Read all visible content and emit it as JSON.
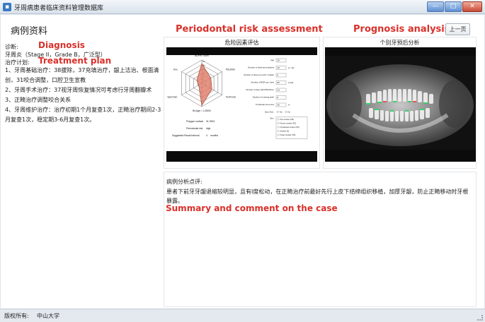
{
  "window": {
    "title": "牙周病患者临床资料管理数据库",
    "buttons": {
      "minimize": "—",
      "maximize": "□",
      "close": "✕"
    }
  },
  "header": {
    "page_title": "病例资料",
    "annotations": {
      "risk": "Periodontal risk assessment",
      "prognosis": "Prognosis analysis"
    },
    "prev_button": "上一页"
  },
  "case": {
    "diagnosis_label": "诊断:",
    "diagnosis_annotation": "Diagnosis",
    "diagnosis_text": "牙周炎（Stage II，Grade B，广泛型）",
    "plan_label": "治疗计划:",
    "plan_annotation": "Treatment plan",
    "steps": [
      "1、牙周基础治疗：38拔除，37充填治疗，龈上洁治、根面清创，31咬合调整，口腔卫生宣教",
      "2、牙周手术治疗：37视牙周恢复情况可考虑行牙周翻瓣术",
      "3、正畸治疗调整咬合关系",
      "4、牙周维护治疗：治疗初期1个月复查1次，正畸治疗期间2-3月复查1次，稳定期3-6月复查1次。"
    ]
  },
  "risk_panel": {
    "caption": "危险因素评估",
    "radar": {
      "axes": [
        "BOP% = 64%",
        "PD≥5mm",
        "Tooth loss",
        "BL/Age = 1.00000",
        "Syst./Gen.",
        "Env."
      ],
      "ring_labels": [
        "4",
        "8",
        "10",
        "15",
        "20",
        "25"
      ],
      "values": [
        0.85,
        0.45,
        0.5,
        0.95,
        0.15,
        0.25
      ],
      "fill_color": "#e07a66"
    },
    "summary": {
      "polygon_surface_label": "Polygon surface",
      "polygon_surface_value": "31.0924",
      "risk_label": "Periodontal risk",
      "risk_value": "high",
      "recall_label": "Suggested Recall interval",
      "recall_value": "4",
      "recall_unit": "months"
    },
    "form": {
      "rows": [
        {
          "label": "age",
          "value": "30",
          "unit": ""
        },
        {
          "label": "Number of teeth and implants",
          "value": "20",
          "unit": "(1 - 32)"
        },
        {
          "label": "Number of sites per tooth / implant",
          "value": "6",
          "unit": ""
        },
        {
          "label": "Number of BOP-pos. sites",
          "value": "80",
          "unit": "of  120"
        },
        {
          "label": "Number of sites with PPD≥5mm",
          "value": "24",
          "unit": ""
        },
        {
          "label": "Number of missing teeth",
          "value": "8",
          "unit": ""
        },
        {
          "label": "% Alveolar bone loss",
          "value": "30",
          "unit": "%"
        }
      ],
      "syst_label": "Syst./Gen.",
      "syst_options": [
        "Yes",
        "No"
      ],
      "env_label": "Env.",
      "env_options": [
        "Non-smoker (NS)",
        "Former smoker (FS)",
        "Occasional smoker (OS)",
        "Smoker (S)",
        "Heavy smoker (HS)"
      ]
    }
  },
  "prognosis_panel": {
    "caption": "个别牙预后分析"
  },
  "comment": {
    "title": "病例分析点评:",
    "text": "患者下前牙牙龈退缩较明显，且有I度松动，在正畸治疗前最好先行上皮下结缔组织移植，加厚牙龈，防止正畸移动时牙根暴露。",
    "annotation": "Summary and comment on the case"
  },
  "status": {
    "label": "版权所有:",
    "value": "中山大学"
  }
}
